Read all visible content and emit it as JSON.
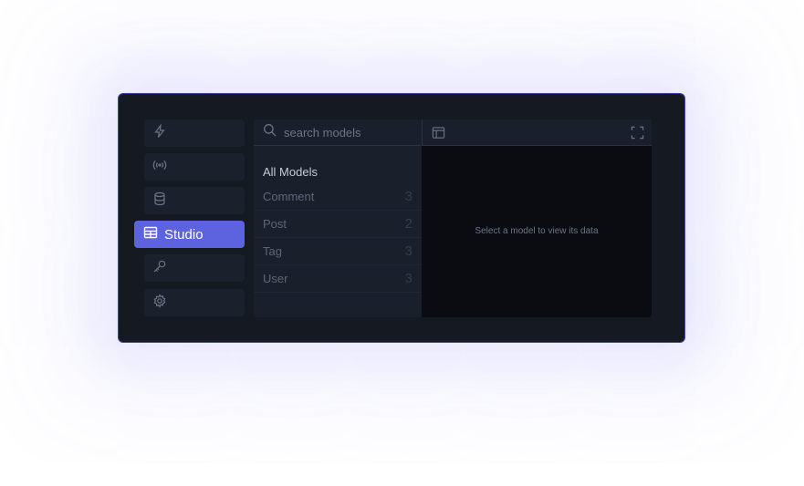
{
  "nav": {
    "items": [
      {
        "icon": "bolt-icon"
      },
      {
        "icon": "broadcast-icon"
      },
      {
        "icon": "database-icon"
      },
      {
        "icon": "table-icon",
        "label": "Studio",
        "active": true
      },
      {
        "icon": "key-icon"
      },
      {
        "icon": "gear-icon"
      }
    ]
  },
  "models": {
    "search_placeholder": "search models",
    "all_label": "All Models",
    "items": [
      {
        "name": "Comment",
        "count": "3"
      },
      {
        "name": "Post",
        "count": "2"
      },
      {
        "name": "Tag",
        "count": "3"
      },
      {
        "name": "User",
        "count": "3"
      }
    ]
  },
  "viewer": {
    "empty_message": "Select a model to view its data"
  },
  "colors": {
    "accent": "#5d63df",
    "window_bg": "#141922",
    "border": "#3f46a8"
  }
}
